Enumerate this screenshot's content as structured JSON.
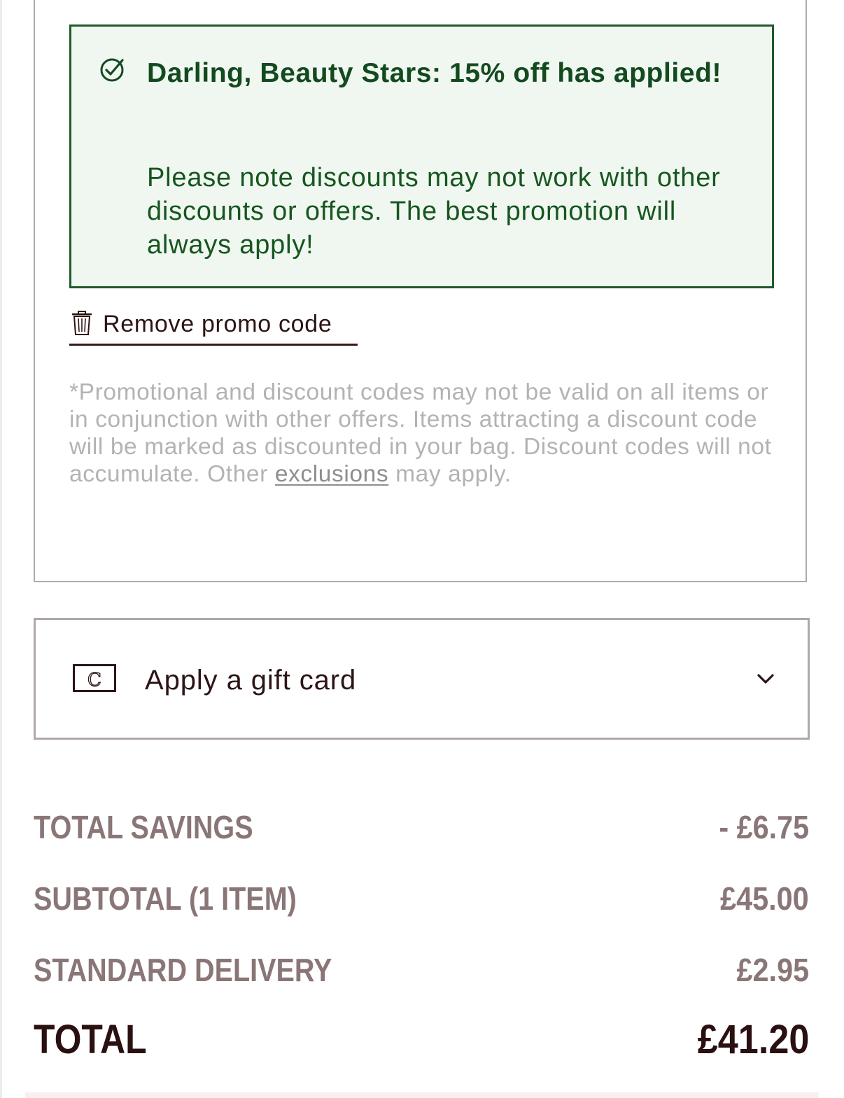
{
  "promo": {
    "success_title": "Darling, Beauty Stars: 15% off has applied!",
    "success_note": "Please note discounts may not work with other discounts or offers. The best promotion will always apply!",
    "success_icon": "check-circle-icon",
    "remove_label": "Remove promo code",
    "remove_icon": "trash-icon",
    "disclaimer_before": "*Promotional and discount codes may not be valid on all items or in conjunction with other offers. Items attracting a discount code will be marked as discounted in your bag. Discount codes will not accumulate. Other ",
    "disclaimer_link": "exclusions",
    "disclaimer_after": " may apply."
  },
  "gift_card": {
    "label": "Apply a gift card",
    "icon": "gift-card-icon",
    "icon_glyph": "C",
    "toggle_icon": "chevron-down-icon"
  },
  "summary": {
    "rows": [
      {
        "label": "TOTAL SAVINGS",
        "value": "- £6.75"
      },
      {
        "label": "SUBTOTAL (1 ITEM)",
        "value": "£45.00"
      },
      {
        "label": "STANDARD DELIVERY",
        "value": "£2.95"
      }
    ],
    "total_label": "TOTAL",
    "total_value": "£41.20"
  },
  "colors": {
    "success_border": "#1f5a2a",
    "success_background": "#f0f7f1",
    "success_text": "#134a1f",
    "summary_muted_text": "#8a7676",
    "total_text": "#2a1010",
    "disclaimer_text": "#b3b3b3"
  }
}
